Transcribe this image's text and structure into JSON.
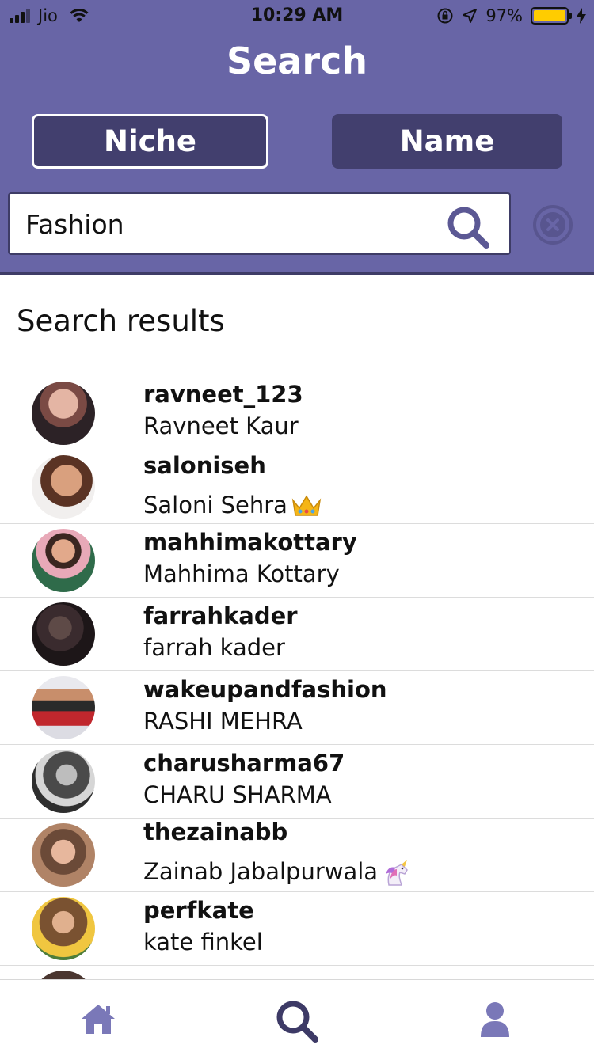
{
  "status_bar": {
    "carrier": "Jio",
    "time": "10:29 AM",
    "battery": "97%",
    "battery_level": 0.97
  },
  "header": {
    "title": "Search",
    "tabs": [
      {
        "label": "Niche",
        "selected": true
      },
      {
        "label": "Name",
        "selected": false
      }
    ]
  },
  "search": {
    "value": "Fashion",
    "search_icon": "search-icon",
    "clear_icon": "clear-circle-icon"
  },
  "results": {
    "heading": "Search results",
    "items": [
      {
        "username": "ravneet_123",
        "full_name": "Ravneet Kaur",
        "emoji": ""
      },
      {
        "username": "saloniseh",
        "full_name": "Saloni Sehra",
        "emoji": "crown-emoji"
      },
      {
        "username": "mahhimakottary",
        "full_name": "Mahhima Kottary",
        "emoji": ""
      },
      {
        "username": "farrahkader",
        "full_name": "farrah kader",
        "emoji": ""
      },
      {
        "username": "wakeupandfashion",
        "full_name": "RASHI MEHRA",
        "emoji": ""
      },
      {
        "username": "charusharma67",
        "full_name": "CHARU SHARMA",
        "emoji": ""
      },
      {
        "username": "thezainabb",
        "full_name": "Zainab Jabalpurwala",
        "emoji": "unicorn-emoji"
      },
      {
        "username": "perfkate",
        "full_name": "kate finkel",
        "emoji": ""
      }
    ]
  },
  "tab_bar": {
    "items": [
      {
        "icon": "home-icon",
        "active": false
      },
      {
        "icon": "search-icon",
        "active": true
      },
      {
        "icon": "profile-icon",
        "active": false
      }
    ]
  },
  "colors": {
    "header_bg": "#6865a6",
    "tab_bg": "#423f6e",
    "icon_active": "#3d3a66",
    "icon_inactive": "#7a78b8",
    "battery": "#ffcc00"
  }
}
